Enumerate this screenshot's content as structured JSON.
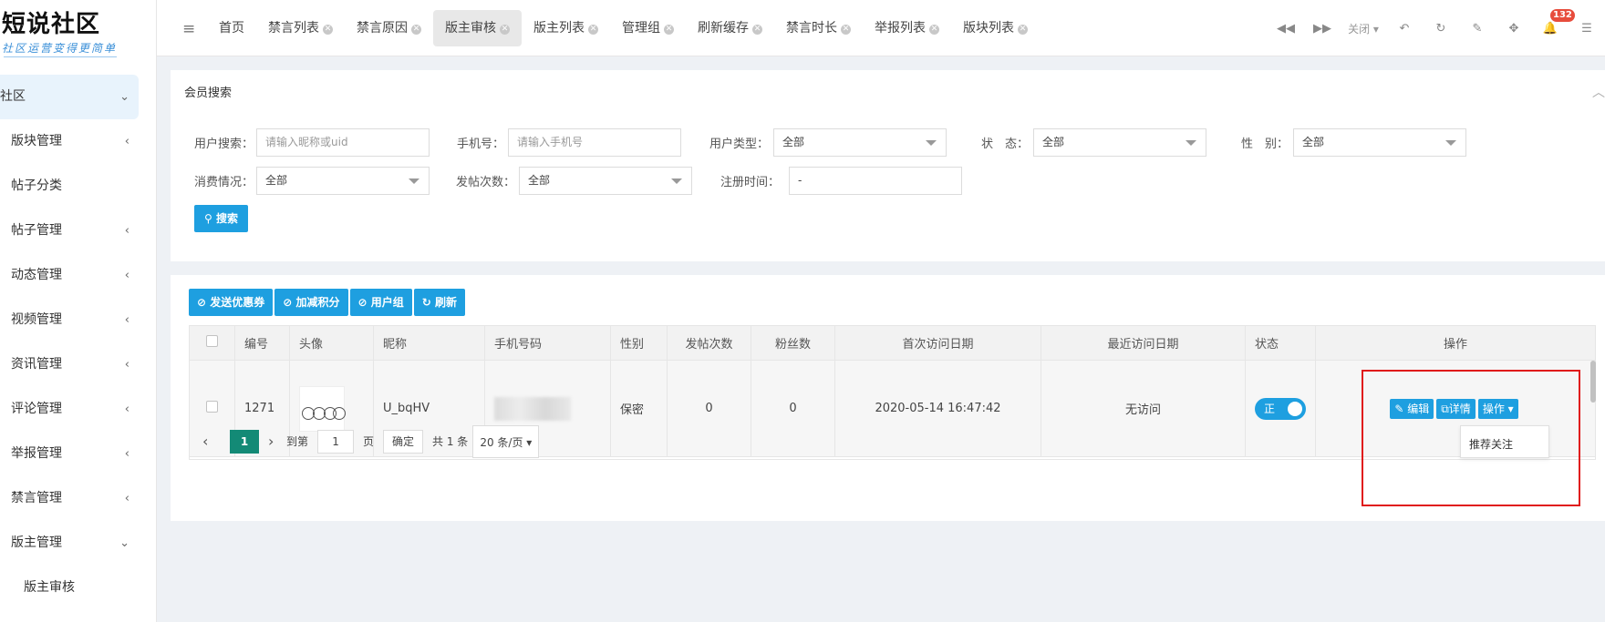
{
  "logo": {
    "title": "短说社区",
    "subtitle": "社区运营变得更简单"
  },
  "sidebar": {
    "items": [
      {
        "label": "社区",
        "chevron": "⌄"
      },
      {
        "label": "版块管理",
        "chevron": "‹"
      },
      {
        "label": "帖子分类",
        "chevron": ""
      },
      {
        "label": "帖子管理",
        "chevron": "‹"
      },
      {
        "label": "动态管理",
        "chevron": "‹"
      },
      {
        "label": "视频管理",
        "chevron": "‹"
      },
      {
        "label": "资讯管理",
        "chevron": "‹"
      },
      {
        "label": "评论管理",
        "chevron": "‹"
      },
      {
        "label": "举报管理",
        "chevron": "‹"
      },
      {
        "label": "禁言管理",
        "chevron": "‹"
      },
      {
        "label": "版主管理",
        "chevron": "⌄"
      },
      {
        "label": "版主审核",
        "chevron": ""
      }
    ]
  },
  "tabs": [
    {
      "label": "首页",
      "closable": false
    },
    {
      "label": "禁言列表",
      "closable": true
    },
    {
      "label": "禁言原因",
      "closable": true
    },
    {
      "label": "版主审核",
      "closable": true,
      "active": true
    },
    {
      "label": "版主列表",
      "closable": true
    },
    {
      "label": "管理组",
      "closable": true
    },
    {
      "label": "刷新缓存",
      "closable": true
    },
    {
      "label": "禁言时长",
      "closable": true
    },
    {
      "label": "举报列表",
      "closable": true
    },
    {
      "label": "版块列表",
      "closable": true
    }
  ],
  "tools": {
    "close_label": "关闭",
    "notification_count": "132"
  },
  "search": {
    "title": "会员搜索",
    "fields": {
      "user_search": {
        "label": "用户搜索：",
        "placeholder": "请输入昵称或uid"
      },
      "phone": {
        "label": "手机号：",
        "placeholder": "请输入手机号"
      },
      "user_type": {
        "label": "用户类型：",
        "value": "全部"
      },
      "status": {
        "label": "状　态：",
        "value": "全部"
      },
      "gender": {
        "label": "性　别：",
        "value": "全部"
      },
      "consumption": {
        "label": "消费情况：",
        "value": "全部"
      },
      "post_count": {
        "label": "发帖次数：",
        "value": "全部"
      },
      "register_time": {
        "label": "注册时间：",
        "value": "-"
      }
    },
    "search_button": "搜索"
  },
  "toolbar": {
    "send_coupon": "发送优惠券",
    "adjust_points": "加减积分",
    "user_group": "用户组",
    "refresh": "刷新"
  },
  "table": {
    "headers": [
      "编号",
      "头像",
      "昵称",
      "手机号码",
      "性别",
      "发帖次数",
      "粉丝数",
      "首次访问日期",
      "最近访问日期",
      "状态",
      "操作"
    ],
    "rows": [
      {
        "id": "1271",
        "nickname": "U_bqHV",
        "gender": "保密",
        "posts": "0",
        "fans": "0",
        "first_visit": "2020-05-14 16:47:42",
        "last_visit": "无访问",
        "status_label": "正",
        "actions": {
          "edit": "编辑",
          "detail": "详情",
          "more": "操作"
        }
      }
    ],
    "dropdown_item": "推荐关注"
  },
  "pager": {
    "current": "1",
    "goto_label": "到第",
    "goto_value": "1",
    "page_unit": "页",
    "confirm": "确定",
    "total": "共 1 条",
    "page_size": "20 条/页"
  }
}
